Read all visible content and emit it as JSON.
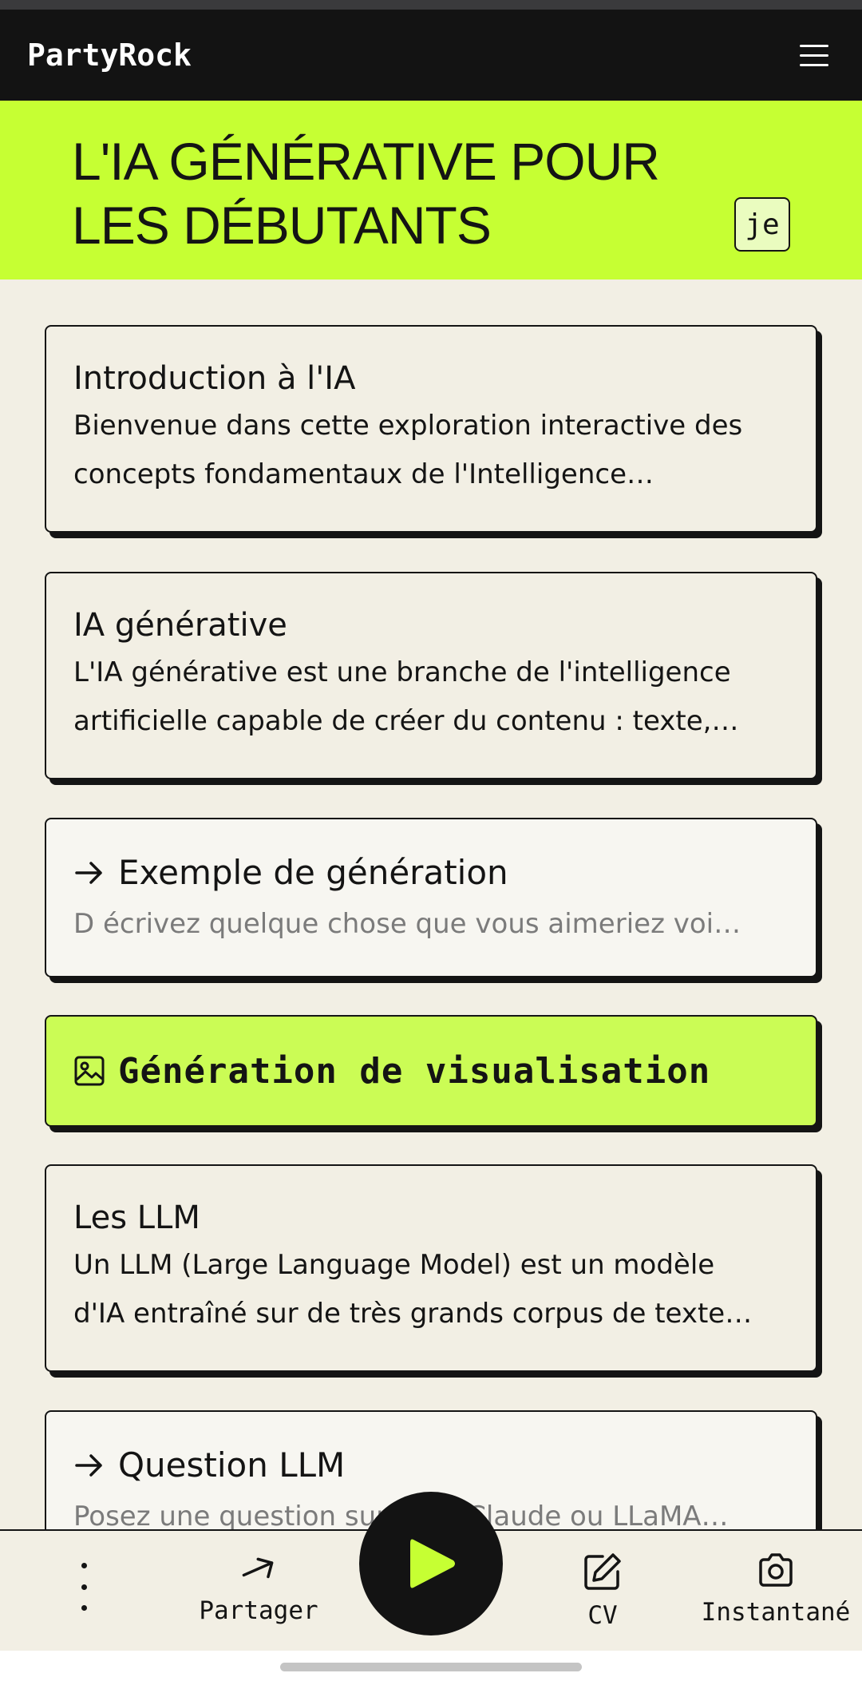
{
  "app": {
    "logo": "PartyRock"
  },
  "banner": {
    "title_line1": "L'IA GÉNÉRATIVE POUR",
    "title_line2": "LES DÉBUTANTS",
    "lang_badge": "je"
  },
  "cards": {
    "intro": {
      "title": "Introduction à l'IA",
      "line1": "Bienvenue dans cette exploration interactive des",
      "line2": "concepts fondamentaux de l'Intelligence…"
    },
    "genai": {
      "title": "IA générative",
      "line1": "L'IA générative est une branche de l'intelligence",
      "line2": "artificielle capable de créer du contenu : texte,…"
    },
    "example": {
      "title": "Exemple de génération",
      "placeholder": "D écrivez quelque chose que vous aimeriez voi…"
    },
    "viz": {
      "title": "Génération de visualisation"
    },
    "llm": {
      "title": "Les LLM",
      "line1": "Un LLM (Large Language Model) est un modèle",
      "line2": "d'IA entraîné sur de très grands corpus de texte…"
    },
    "question": {
      "title": "Question LLM",
      "placeholder": "Posez une question sur GPT, Claude ou LLaMA…"
    }
  },
  "bottom_bar": {
    "share_label": "Partager",
    "cv_label": "CV",
    "snapshot_label": "Instantané"
  },
  "icons": {
    "menu": "hamburger-icon",
    "arrow": "arrow-right-icon",
    "image": "image-icon",
    "more": "more-vertical-icon",
    "share": "share-arrow-icon",
    "play": "play-icon",
    "edit": "edit-icon",
    "camera": "camera-icon"
  },
  "colors": {
    "accent": "#c6ff33",
    "viz_card": "#cbfc55",
    "header": "#131313",
    "background": "#f2efe4"
  }
}
